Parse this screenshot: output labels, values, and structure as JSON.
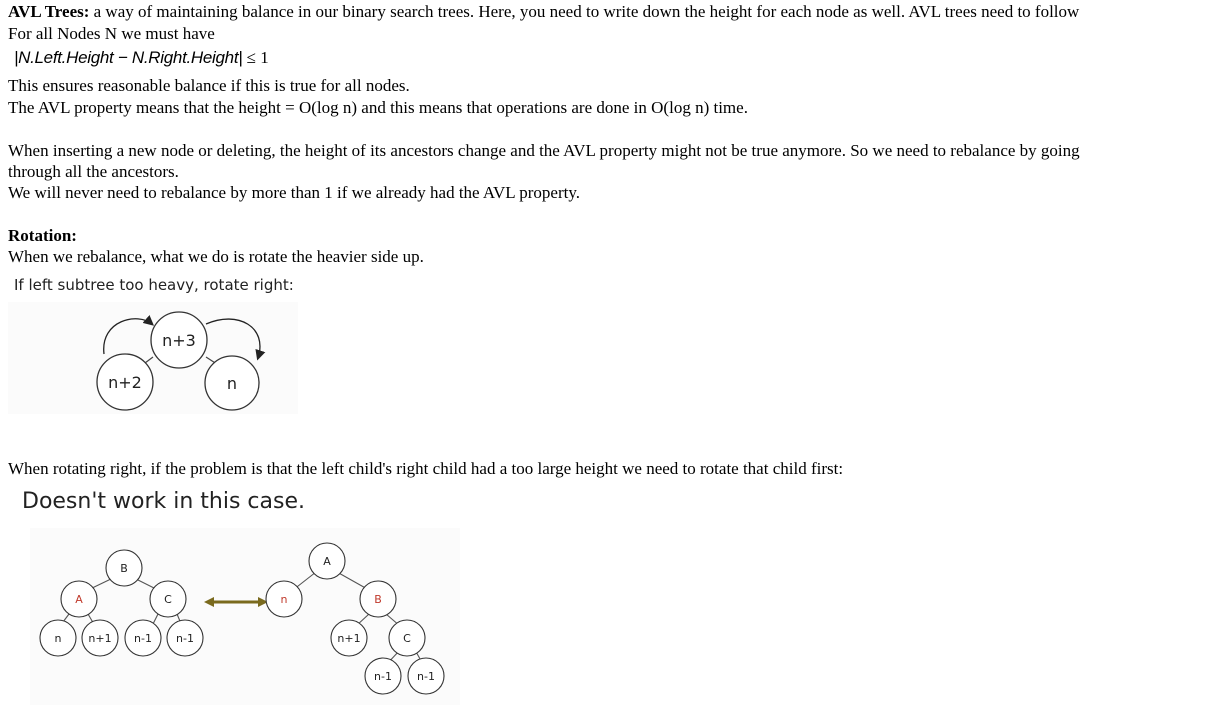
{
  "intro": {
    "title": "AVL Trees:",
    "line1_rest": " a way of maintaining balance in our binary search trees. Here, you need to write down the height for each node as well. AVL trees need to follow",
    "line2": "For all Nodes N we must have"
  },
  "formula": {
    "lhs": "|N.Left.Height − N.Right.Height|",
    "rhs": "≤ 1"
  },
  "balance": {
    "line1": "This ensures reasonable balance if this is true for all nodes.",
    "line2": "The AVL property means that the height = O(log n) and this means that operations are done in O(log n) time."
  },
  "rebalance": {
    "line1": "When inserting a new node or deleting, the height of its ancestors change and the AVL property might not be true anymore. So we need to rebalance by going",
    "line2": "through all the ancestors.",
    "line3": "We will never need to rebalance by more than 1 if we already had the AVL property."
  },
  "rotation": {
    "heading": "Rotation:",
    "text": "When we rebalance, what we do is rotate the heavier side up.",
    "caption": "If left subtree too heavy, rotate right:"
  },
  "figure1": {
    "root": "n+3",
    "left": "n+2",
    "right": "n"
  },
  "double": {
    "text": "When rotating right, if the problem is that the left child's right child had a too large height we need to rotate that child first:",
    "caption": "Doesn't work in this case."
  },
  "figure2": {
    "left_tree": {
      "root": "B",
      "a": "A",
      "c": "C",
      "a_left": "n",
      "a_right": "n+1",
      "c_left": "n-1",
      "c_right": "n-1"
    },
    "right_tree": {
      "root": "A",
      "n": "n",
      "b": "B",
      "b_left": "n+1",
      "c": "C",
      "c_left": "n-1",
      "c_right": "n-1"
    },
    "arrow_color": "#7a6a1e"
  }
}
